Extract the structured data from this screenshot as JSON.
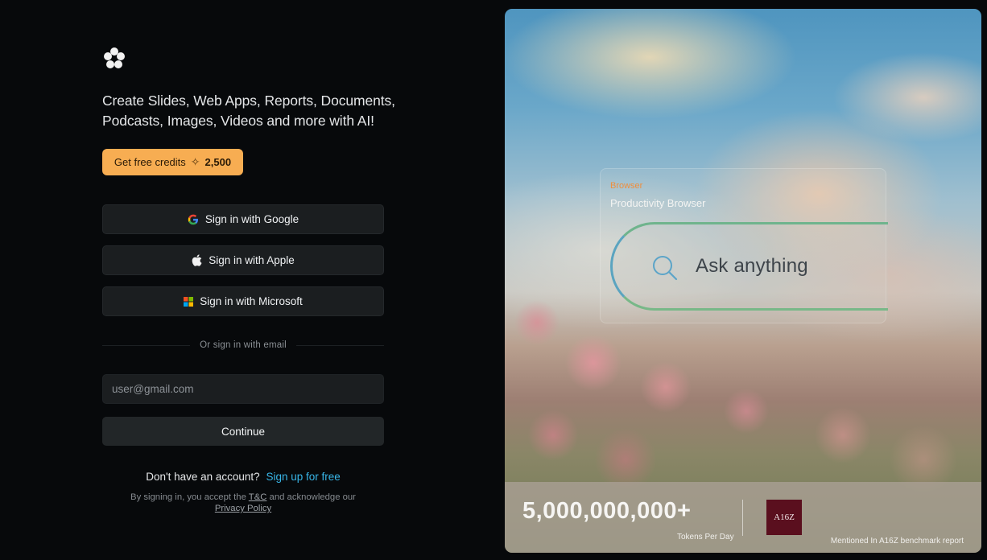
{
  "left": {
    "logo": "flower-logo-icon",
    "tagline_line1": "Create Slides, Web Apps, Reports, Documents,",
    "tagline_line2": "Podcasts, Images, Videos and more with AI!",
    "credits": {
      "label": "Get free credits",
      "amount": "2,500",
      "icon": "sparkle-icon"
    },
    "oauth": {
      "google": "Sign in with Google",
      "apple": "Sign in with Apple",
      "microsoft": "Sign in with Microsoft"
    },
    "divider": "Or sign in with email",
    "email_placeholder": "user@gmail.com",
    "continue": "Continue",
    "signup_prompt": "Don't have an account?",
    "signup_link": "Sign up for free",
    "legal_prefix": "By signing in, you accept the",
    "legal_tc": "T&C",
    "legal_middle": "and acknowledge our",
    "legal_privacy": "Privacy Policy"
  },
  "right": {
    "browser_tag": "Browser",
    "browser_title": "Productivity Browser",
    "search_placeholder": "Ask anything",
    "stats_number": "5,000,000,000+",
    "stats_label": "Tokens Per Day",
    "badge": "A16Z",
    "caption": "Mentioned In A16Z benchmark report"
  },
  "colors": {
    "background": "#07090b",
    "credits_bg": "#f7ad52",
    "button_bg": "#1b1e20",
    "link": "#38b6e8",
    "browser_tag": "#ef8e3c",
    "badge_bg": "#5a0f1e"
  }
}
